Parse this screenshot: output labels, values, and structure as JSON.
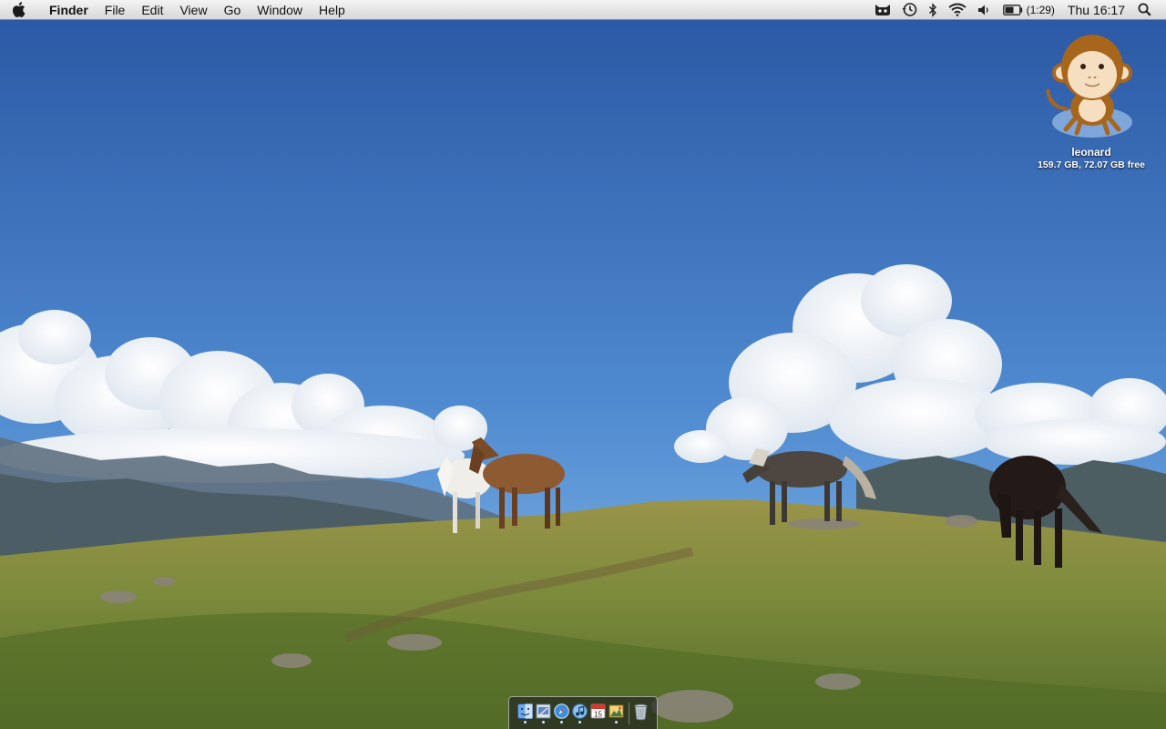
{
  "menubar": {
    "apple_icon": "apple-logo",
    "app_name": "Finder",
    "menus": [
      "File",
      "Edit",
      "View",
      "Go",
      "Window",
      "Help"
    ],
    "status_icons": [
      "cat-icon",
      "time-machine-icon",
      "bluetooth-icon",
      "wifi-icon",
      "volume-icon",
      "battery-icon"
    ],
    "battery_text": "(1:29)",
    "clock": "Thu 16:17",
    "spotlight_icon": "search-icon"
  },
  "desktop": {
    "wallpaper": "alpine-meadow-with-horses",
    "disk": {
      "name": "leonard",
      "info": "159.7 GB, 72.07 GB free"
    }
  },
  "dock": {
    "items": [
      {
        "name": "finder",
        "running": true
      },
      {
        "name": "mail",
        "running": true
      },
      {
        "name": "safari",
        "running": true
      },
      {
        "name": "itunes",
        "running": true
      },
      {
        "name": "ical",
        "running": false,
        "date": "15"
      },
      {
        "name": "iphoto",
        "running": true
      },
      {
        "name": "trash",
        "running": false
      }
    ]
  },
  "colors": {
    "sky_top": "#2d5ea9",
    "sky_bottom": "#7cb2e6",
    "grass": "#7a8a3e",
    "menubar": "#e6e6e6"
  }
}
